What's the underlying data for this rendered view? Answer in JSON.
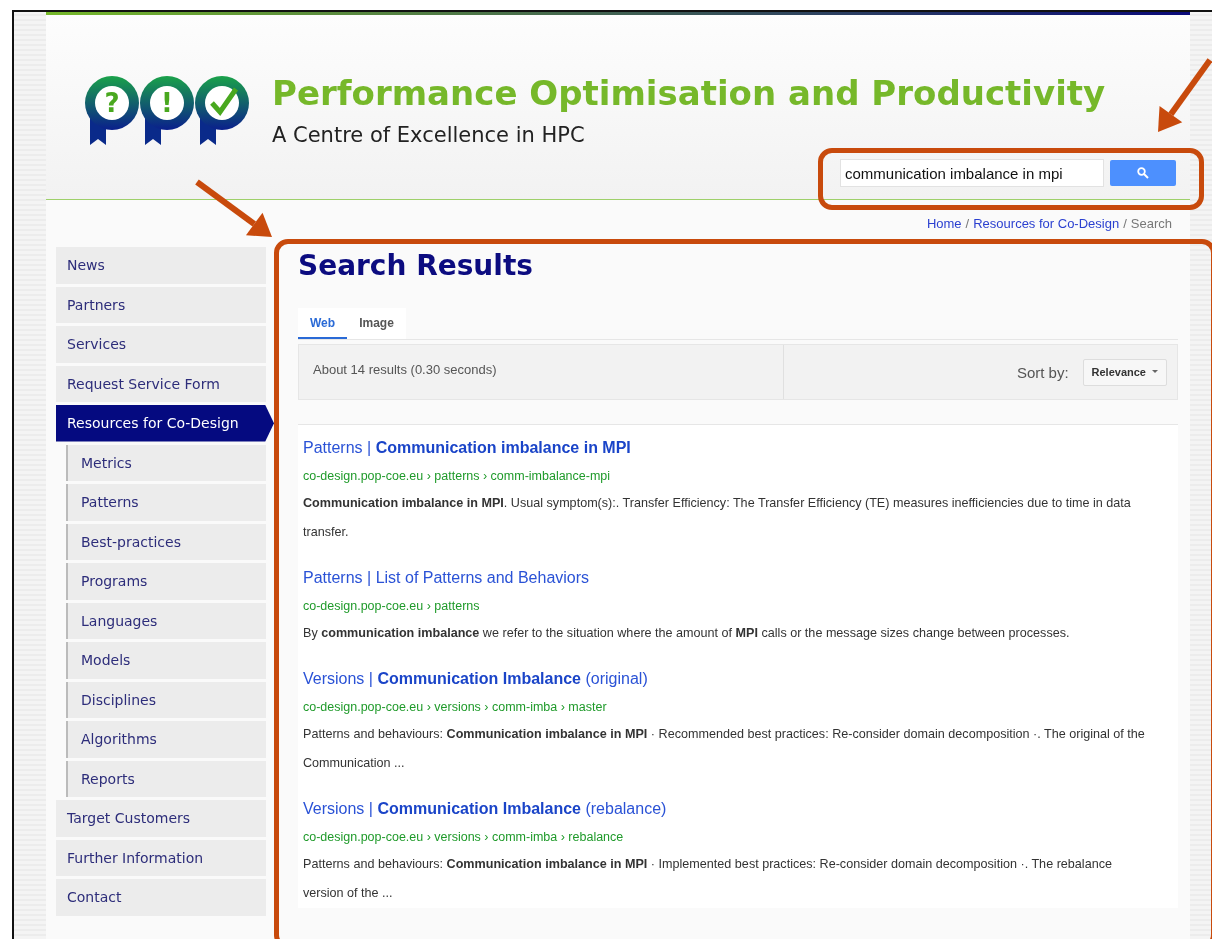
{
  "header": {
    "logo": {
      "marks": [
        "?",
        "!"
      ]
    },
    "title": "Performance Optimisation and Productivity",
    "subtitle": "A Centre of Excellence in HPC"
  },
  "search": {
    "value": "communication imbalance in mpi"
  },
  "breadcrumb": [
    {
      "label": "Home",
      "kind": "link"
    },
    {
      "label": "/",
      "kind": "separator"
    },
    {
      "label": "Resources for Co-Design",
      "kind": "link"
    },
    {
      "label": "/",
      "kind": "separator"
    },
    {
      "label": "Search",
      "kind": "current"
    }
  ],
  "sidebar": {
    "items": [
      {
        "label": "News",
        "selected": false
      },
      {
        "label": "Partners",
        "selected": false
      },
      {
        "label": "Services",
        "selected": false
      },
      {
        "label": "Request Service Form",
        "selected": false
      },
      {
        "label": "Resources for Co-Design",
        "selected": true,
        "children": [
          {
            "label": "Metrics",
            "selected": false
          },
          {
            "label": "Patterns",
            "selected": false
          },
          {
            "label": "Best-practices",
            "selected": false
          },
          {
            "label": "Programs",
            "selected": false
          },
          {
            "label": "Languages",
            "selected": false
          },
          {
            "label": "Models",
            "selected": false
          },
          {
            "label": "Disciplines",
            "selected": false
          },
          {
            "label": "Algorithms",
            "selected": false
          },
          {
            "label": "Reports",
            "selected": false
          }
        ]
      },
      {
        "label": "Target Customers",
        "selected": false
      },
      {
        "label": "Further Information",
        "selected": false
      },
      {
        "label": "Contact",
        "selected": false
      }
    ]
  },
  "page_title": "Search Results",
  "tabs": [
    {
      "label": "Web",
      "selected": true
    },
    {
      "label": "Image",
      "selected": false
    }
  ],
  "results_info": "About 14 results (0.30 seconds)",
  "sort": {
    "label": "Sort by:",
    "value": "Relevance"
  },
  "results": [
    {
      "title": "Patterns | **Communication imbalance in MPI**",
      "url": "co-design.pop-coe.eu › patterns › comm-imbalance-mpi",
      "snippet": "**Communication imbalance in MPI**. Usual symptom(s):. Transfer Efficiency: The Transfer Efficiency (TE) measures inefficiencies due to time in data transfer."
    },
    {
      "title": "Patterns | List of Patterns and Behaviors",
      "url": "co-design.pop-coe.eu › patterns",
      "snippet": "By **communication imbalance** we refer to the situation where the amount of **MPI** calls or the message sizes change between processes."
    },
    {
      "title": "Versions | **Communication Imbalance** (original)",
      "url": "co-design.pop-coe.eu › versions › comm-imba › master",
      "snippet": "Patterns and behaviours: **Communication imbalance in MPI** · Recommended best practices: Re-consider domain decomposition ·. The original of the Communication ..."
    },
    {
      "title": "Versions | **Communication Imbalance** (rebalance)",
      "url": "co-design.pop-coe.eu › versions › comm-imba › rebalance",
      "snippet": "Patterns and behaviours: **Communication imbalance in MPI** · Implemented best practices: Re-consider domain decomposition ·. The rebalance version of the ..."
    }
  ]
}
